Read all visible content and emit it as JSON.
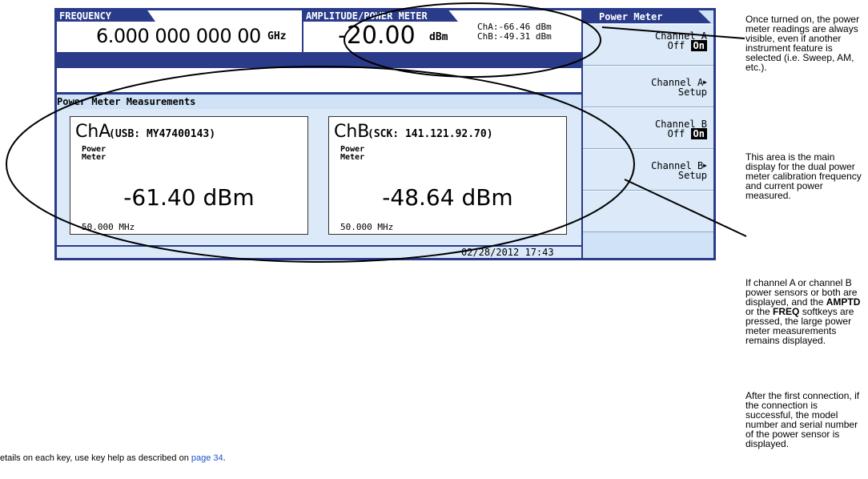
{
  "frequency": {
    "label": "FREQUENCY",
    "value": "6.000 000 000 00",
    "unit": "GHz"
  },
  "amplitude": {
    "label": "AMPLITUDE/POWER METER",
    "value": "-20.00",
    "unit": "dBm",
    "cha_reading": "ChA:-66.46 dBm",
    "chb_reading": "ChB:-49.31 dBm"
  },
  "measurements": {
    "title": "Power Meter Measurements",
    "channel_a": {
      "name": "ChA",
      "id": "(USB: MY47400143)",
      "sub1": "Power",
      "sub2": "Meter",
      "value": "-61.40 dBm",
      "cal_freq": "50.000 MHz"
    },
    "channel_b": {
      "name": "ChB",
      "id": "(SCK: 141.121.92.70)",
      "sub1": "Power",
      "sub2": "Meter",
      "value": "-48.64 dBm",
      "cal_freq": "50.000 MHz"
    }
  },
  "status": {
    "timestamp": "02/28/2012 17:43"
  },
  "softkeys": {
    "title": "Power Meter",
    "items": [
      {
        "line1": "Channel A",
        "line2_prefix": "Off",
        "line2_on": "On"
      },
      {
        "line1": "Channel A",
        "line2": "Setup"
      },
      {
        "line1": "Channel B",
        "line2_prefix": "Off",
        "line2_on": "On"
      },
      {
        "line1": "Channel B",
        "line2": "Setup"
      }
    ]
  },
  "notes": {
    "note1": "Once turned on, the power meter readings are always visible, even if another instrument feature is selected (i.e. Sweep, AM, etc.).",
    "note2": "This area is the main display for the dual power meter calibration frequency and current power measured.",
    "note3_a": "If channel A or channel B power sensors or both are displayed, and the ",
    "note3_b1": "AMPTD",
    "note3_c": " or the ",
    "note3_b2": "FREQ",
    "note3_d": " softkeys are pressed, the large power meter measurements remains displayed.",
    "note4": "After the first connection, if the connection is successful, the model number and serial number of the power sensor is displayed."
  },
  "footer": {
    "text": "etails on each key, use key help as described on ",
    "link": "page 34",
    "end": "."
  },
  "colors": {
    "frame": "#2a3b8a",
    "panel_light": "#dbe9f8",
    "link": "#1a55c8"
  }
}
